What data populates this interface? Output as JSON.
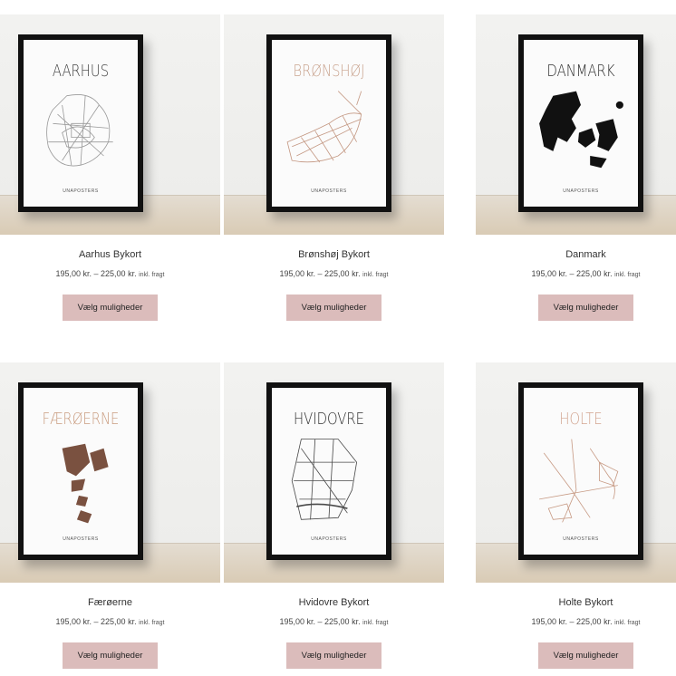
{
  "products": [
    {
      "name": "Aarhus Bykort",
      "poster_title": "AARHUS",
      "title_color": "#3c3c3c",
      "price": "195,00 kr. – 225,00 kr.",
      "tax_note": "inkl. fragt",
      "button": "Vælg muligheder",
      "brand": "UNAPOSTERS",
      "map_icon": "aarhus-map-icon",
      "map_color": "#9a9a9a"
    },
    {
      "name": "Brønshøj Bykort",
      "poster_title": "BRØNSHØJ",
      "title_color": "#c9a38e",
      "price": "195,00 kr. – 225,00 kr.",
      "tax_note": "inkl. fragt",
      "button": "Vælg muligheder",
      "brand": "UNAPOSTERS",
      "map_icon": "bronshoj-map-icon",
      "map_color": "#c49883"
    },
    {
      "name": "Danmark",
      "poster_title": "DANMARK",
      "title_color": "#2b2b2b",
      "price": "195,00 kr. – 225,00 kr.",
      "tax_note": "inkl. fragt",
      "button": "Vælg muligheder",
      "brand": "UNAPOSTERS",
      "map_icon": "denmark-map-icon",
      "map_color": "#111111"
    },
    {
      "name": "Færøerne",
      "poster_title": "FÆRØERNE",
      "title_color": "#c99b7e",
      "price": "195,00 kr. – 225,00 kr.",
      "tax_note": "inkl. fragt",
      "button": "Vælg muligheder",
      "brand": "UNAPOSTERS",
      "map_icon": "faroe-map-icon",
      "map_color": "#7a5140"
    },
    {
      "name": "Hvidovre Bykort",
      "poster_title": "HVIDOVRE",
      "title_color": "#2e2e2e",
      "price": "195,00 kr. – 225,00 kr.",
      "tax_note": "inkl. fragt",
      "button": "Vælg muligheder",
      "brand": "UNAPOSTERS",
      "map_icon": "hvidovre-map-icon",
      "map_color": "#4a4a4a"
    },
    {
      "name": "Holte Bykort",
      "poster_title": "HOLTE",
      "title_color": "#d2a590",
      "price": "195,00 kr. – 225,00 kr.",
      "tax_note": "inkl. fragt",
      "button": "Vælg muligheder",
      "brand": "UNAPOSTERS",
      "map_icon": "holte-map-icon",
      "map_color": "#c79a84"
    }
  ]
}
